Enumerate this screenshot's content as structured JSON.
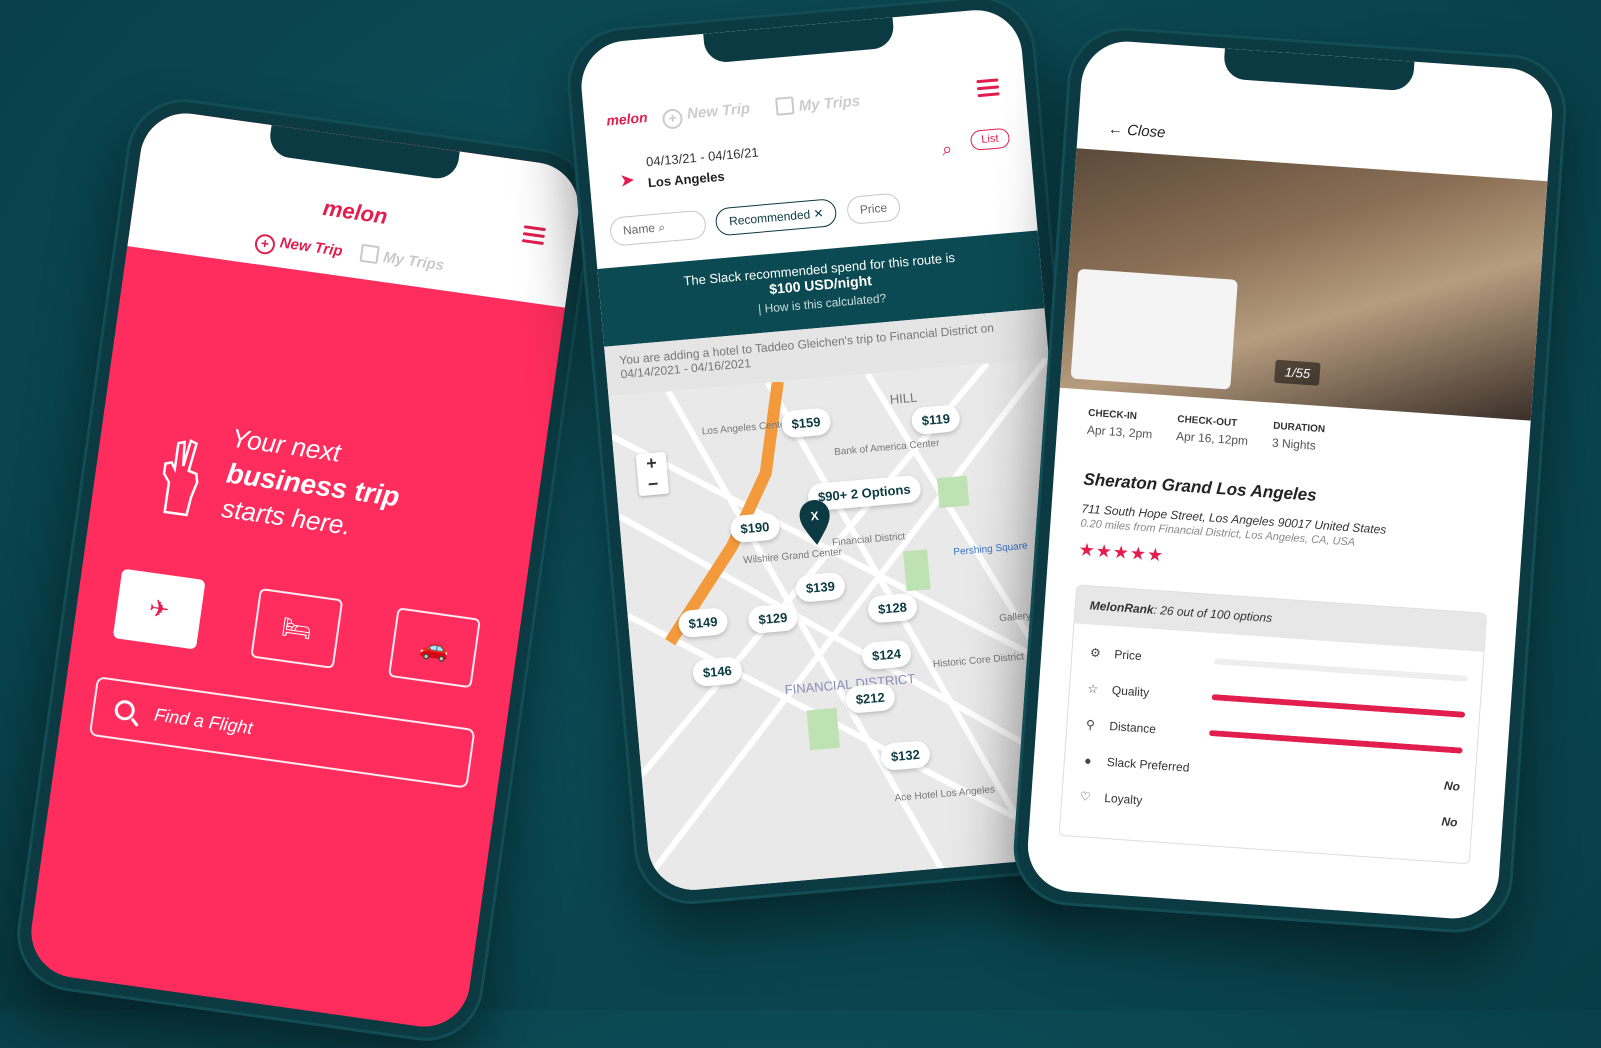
{
  "brand": {
    "logo": "melon",
    "accent": "#e11e4e",
    "dark": "#0b3a42"
  },
  "phone1": {
    "nav": {
      "new_trip": "New Trip",
      "my_trips": "My Trips"
    },
    "hero": {
      "line1": "Your next",
      "line2": "business trip",
      "line3": "starts here."
    },
    "modes": [
      {
        "icon": "airplane-icon",
        "glyph": "✈"
      },
      {
        "icon": "bed-icon",
        "glyph": "🛏"
      },
      {
        "icon": "car-icon",
        "glyph": "🚗"
      }
    ],
    "search_placeholder": "Find a Flight"
  },
  "phone2": {
    "nav": {
      "new_trip": "New Trip",
      "my_trips": "My Trips"
    },
    "dates": "04/13/21 - 04/16/21",
    "location": "Los Angeles",
    "list_button": "List",
    "filters": {
      "name": "Name",
      "recommended": "Recommended ✕",
      "price": "Price"
    },
    "banner": {
      "line1": "The Slack recommended spend for this route is",
      "amount": "$100 USD/night",
      "how": "| How is this calculated?"
    },
    "context": "You are adding a hotel to Taddeo Gleichen's trip to Financial District on 04/14/2021 - 04/16/2021",
    "pins": [
      "$159",
      "$119",
      "$90+ 2 Options",
      "$190",
      "$139",
      "$149",
      "$129",
      "$128",
      "$146",
      "$124",
      "$212",
      "$132"
    ],
    "map_labels": [
      "Los Angeles Center Studios",
      "Bank of America Center",
      "Wilshire Grand Center",
      "Pershing Square",
      "FINANCIAL DISTRICT",
      "Historic Core District",
      "Gallery Row",
      "Ace Hotel Los Angeles",
      "HILL",
      "Financial District"
    ]
  },
  "phone3": {
    "close": "Close",
    "photo_counter": "1/55",
    "checkin": {
      "label": "CHECK-IN",
      "value": "Apr 13, 2pm"
    },
    "checkout": {
      "label": "CHECK-OUT",
      "value": "Apr 16, 12pm"
    },
    "duration": {
      "label": "DURATION",
      "value": "3 Nights"
    },
    "hotel_name": "Sheraton Grand Los Angeles",
    "address": "711 South Hope Street, Los Angeles 90017 United States",
    "distance": "0.20 miles from Financial District, Los Angeles, CA, USA",
    "stars": "★★★★★",
    "rank": {
      "label": "MelonRank",
      "summary": ": 26 out of 100 options",
      "rows": [
        {
          "label": "Price",
          "fill": 0.0
        },
        {
          "label": "Quality",
          "fill": 1.0
        },
        {
          "label": "Distance",
          "fill": 1.0
        },
        {
          "label": "Slack Preferred",
          "value": "No"
        },
        {
          "label": "Loyalty",
          "value": "No"
        }
      ]
    }
  }
}
